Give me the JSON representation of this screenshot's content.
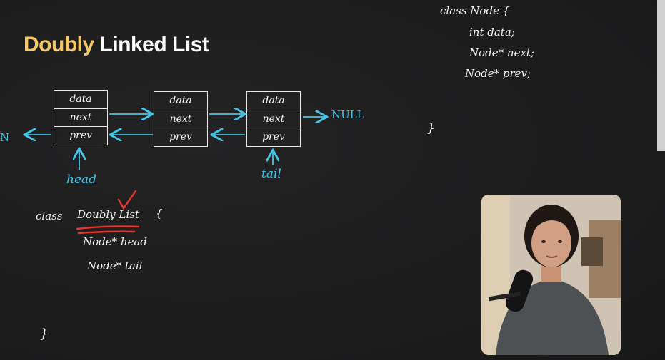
{
  "title": {
    "part1": "Doubly",
    "part2": "Linked List"
  },
  "nodes": [
    {
      "data": "data",
      "next": "next",
      "prev": "prev"
    },
    {
      "data": "data",
      "next": "next",
      "prev": "prev"
    },
    {
      "data": "data",
      "next": "next",
      "prev": "prev"
    }
  ],
  "labels": {
    "left_null": "N",
    "right_null": "NULL",
    "head": "head",
    "tail": "tail"
  },
  "code_node": {
    "line1": "class Node {",
    "line2": "int data;",
    "line3": "Node* next;",
    "line4": "Node* prev;",
    "close": "}"
  },
  "code_list": {
    "line1_kw": "class",
    "line1_name": "Doubly List",
    "line1_brace": "{",
    "line2": "Node* head",
    "line3": "Node* tail",
    "close": "}"
  },
  "colors": {
    "chalk": "#f4f4f4",
    "cyan": "#43c6e8",
    "red": "#e8352b",
    "title_accent": "#f6c766"
  },
  "icons": [
    "checkmark-icon",
    "arrow-icon"
  ]
}
